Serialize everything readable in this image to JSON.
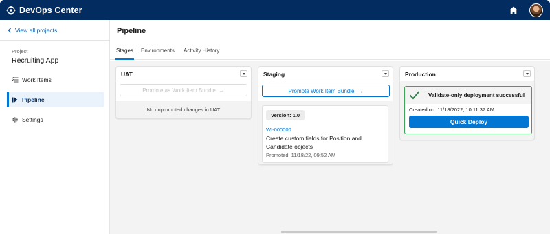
{
  "app": {
    "title": "DevOps Center",
    "brand_icon": "devops-center-logo-icon",
    "home_icon": "home-icon"
  },
  "sidebar": {
    "back_link": "View all projects",
    "project_caption": "Project",
    "project_name": "Recruiting App",
    "items": [
      {
        "label": "Work Items",
        "icon": "list-checks-icon",
        "active": false
      },
      {
        "label": "Pipeline",
        "icon": "pipeline-icon",
        "active": true
      },
      {
        "label": "Settings",
        "icon": "gear-icon",
        "active": false
      }
    ]
  },
  "main": {
    "title": "Pipeline",
    "tabs": [
      {
        "label": "Stages",
        "active": true
      },
      {
        "label": "Environments",
        "active": false
      },
      {
        "label": "Activity History",
        "active": false
      }
    ]
  },
  "stages": {
    "uat": {
      "name": "UAT",
      "promote_label": "Promote as Work Item Bundle",
      "promote_disabled": true,
      "empty_text": "No unpromoted changes in UAT"
    },
    "staging": {
      "name": "Staging",
      "promote_label": "Promote Work Item Bundle",
      "version": "Version: 1.0",
      "work_item": {
        "id": "WI-000000",
        "description": "Create custom fields for Position and Candidate objects",
        "promoted": "Promoted: 11/18/22, 09:52 AM"
      }
    },
    "production": {
      "name": "Production",
      "status": "Validate-only deployment successful",
      "created_on": "Created on: 11/18/2022, 10:11:37 AM",
      "deploy_label": "Quick Deploy"
    }
  },
  "colors": {
    "header": "#032d60",
    "brand": "#0176d3",
    "success": "#3ba755",
    "link": "#0b5cab"
  }
}
